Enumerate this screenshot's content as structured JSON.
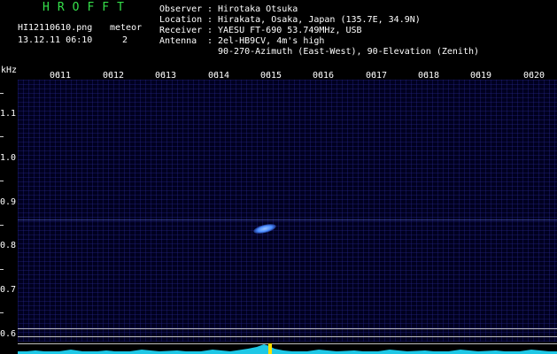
{
  "header": {
    "brand": "HROFFT",
    "filename": "HI12110610.png",
    "datetime": "13.12.11 06:10",
    "meteor_label": "meteor",
    "meteor_count": "2"
  },
  "station": {
    "observer_key": "Observer",
    "observer_val": "Hirotaka Otsuka",
    "location_key": "Location",
    "location_val": "Hirakata, Osaka, Japan (135.7E, 34.9N)",
    "receiver_key": "Receiver",
    "receiver_val": "YAESU FT-690 53.749MHz, USB",
    "antenna_key": "Antenna",
    "antenna_val": "2el-HB9CV, 4m's high",
    "antenna_val2": "90-270-Azimuth (East-West), 90-Elevation (Zenith)",
    "separator": ":"
  },
  "axis": {
    "unit": "kHz",
    "time_labels": [
      "0611",
      "0612",
      "0613",
      "0614",
      "0615",
      "0616",
      "0617",
      "0618",
      "0619",
      "0620"
    ],
    "freq_labels": [
      "1.1",
      "1.0",
      "0.9",
      "0.8",
      "0.7",
      "0.6"
    ]
  },
  "colors": {
    "brand": "#35e04a",
    "background": "#000000",
    "noise": "#00001f",
    "signal": "#4a8cff",
    "baseline": "#1ec8e6",
    "spike": "#ffe000"
  }
}
